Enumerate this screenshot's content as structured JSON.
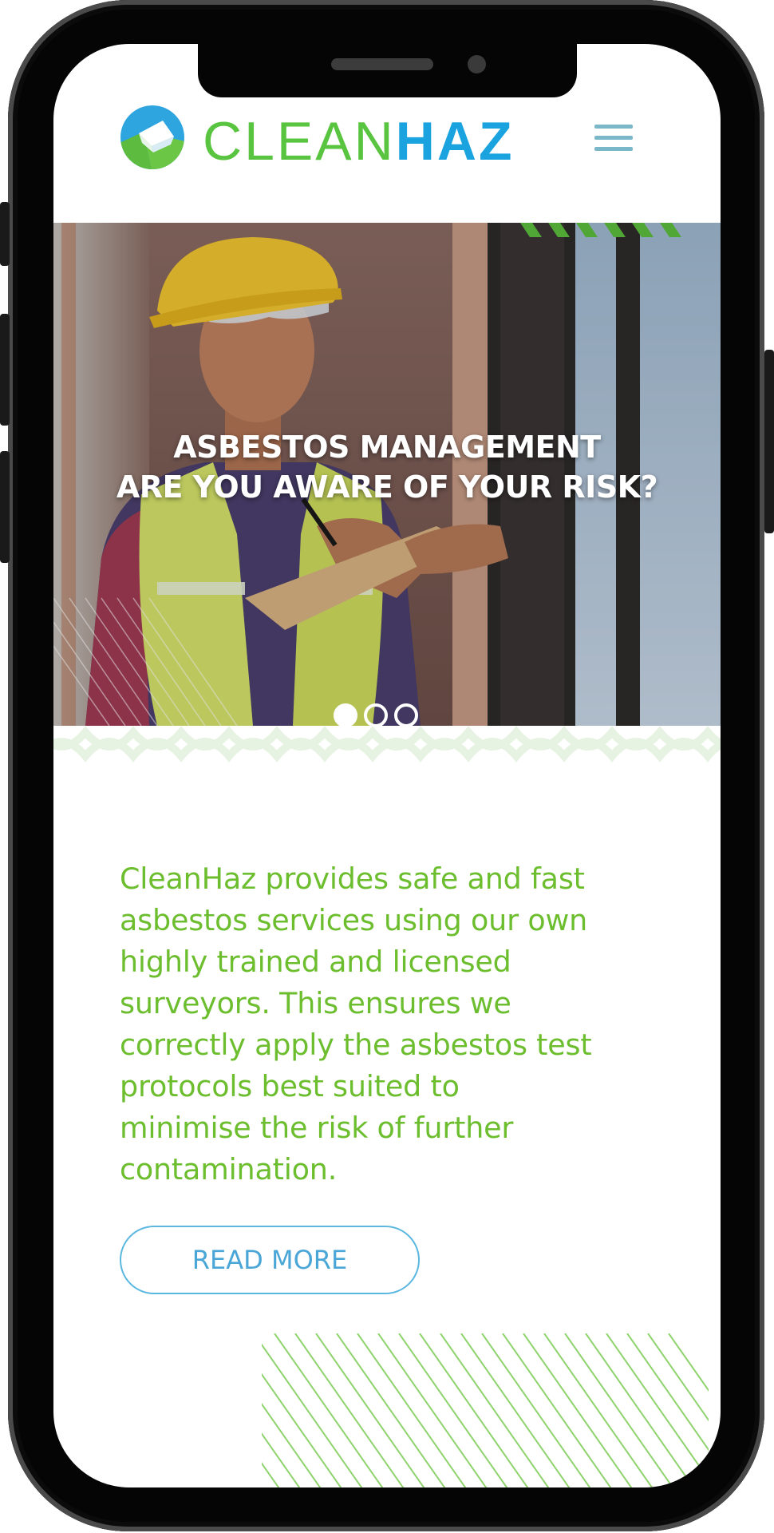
{
  "brand": {
    "name_part1": "CLEAN",
    "name_part2": "HAZ",
    "colors": {
      "green": "#58c43f",
      "blue": "#1ba3e0"
    }
  },
  "header": {
    "menu_icon": "hamburger-menu-icon"
  },
  "hero": {
    "title_line1": "ASBESTOS MANAGEMENT",
    "title_line2": "ARE YOU AWARE OF YOUR RISK?",
    "slide_count": 3,
    "active_slide": 1
  },
  "intro": {
    "lines": [
      "CleanHaz provides safe and fast",
      "asbestos services using our own",
      "highly trained and licensed",
      "surveyors. This ensures we",
      "correctly apply the asbestos test",
      "protocols best suited to",
      "minimise the risk of further",
      "contamination."
    ]
  },
  "cta": {
    "read_more_label": "READ MORE"
  },
  "colors": {
    "accent_green": "#6cbe2e",
    "accent_blue": "#4aa6d6"
  }
}
